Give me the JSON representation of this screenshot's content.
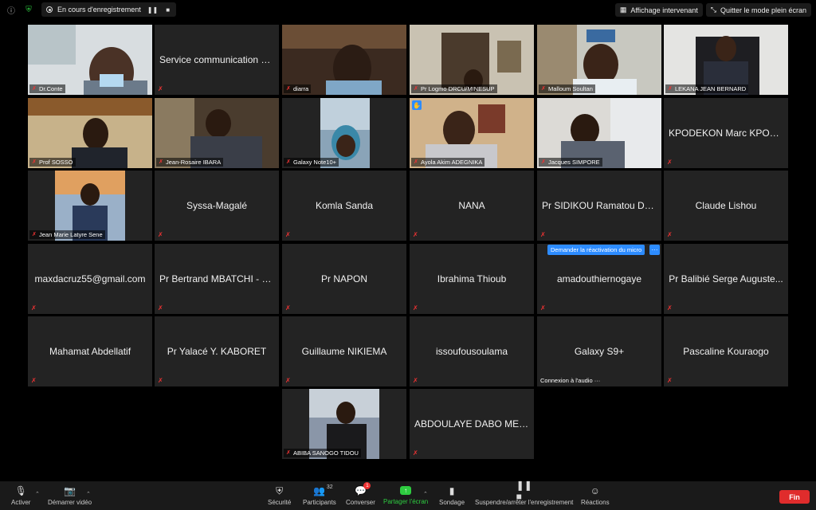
{
  "topbar": {
    "recording_label": "En cours d'enregistrement",
    "speaker_view_label": "Affichage intervenant",
    "exit_fullscreen_label": "Quitter le mode plein écran"
  },
  "participants": {
    "video": [
      {
        "name": "Dr.Conte"
      },
      {
        "name": "diarra"
      },
      {
        "name": "Pr Logmo DRCU/MINESUP"
      },
      {
        "name": "Malloum Soultan"
      },
      {
        "name": "LEKANA JEAN BERNARD"
      },
      {
        "name": "Prof SOSSO"
      },
      {
        "name": "Jean-Rosaire IBARA"
      },
      {
        "name": "Galaxy Note10+"
      },
      {
        "name": "Ayola Akim ADEGNIKA"
      },
      {
        "name": "Jacques SIMPORE"
      },
      {
        "name": "Jean Marie Latyre Sene"
      },
      {
        "name": "ABIBA SANOGO TIDOU"
      }
    ],
    "names_only": [
      {
        "name": "Service communication C..."
      },
      {
        "name": "KPODEKON Marc KPODE..."
      },
      {
        "name": "Syssa-Magalé"
      },
      {
        "name": "Komla Sanda"
      },
      {
        "name": "NANA"
      },
      {
        "name": "Pr SIDIKOU Ramatou D. S."
      },
      {
        "name": "Claude Lishou"
      },
      {
        "name": "maxdacruz55@gmail.com"
      },
      {
        "name": "Pr Bertrand MBATCHI - S..."
      },
      {
        "name": "Pr NAPON"
      },
      {
        "name": "Ibrahima Thioub"
      },
      {
        "name": "amadouthiernogaye"
      },
      {
        "name": "Pr Balibié Serge Auguste..."
      },
      {
        "name": "Mahamat Abdellatif"
      },
      {
        "name": "Pr Yalacé Y. KABORET"
      },
      {
        "name": "Guillaume NIKIEMA"
      },
      {
        "name": "issoufousoulama"
      },
      {
        "name": "Galaxy S9+"
      },
      {
        "name": "Pascaline Kouraogo"
      },
      {
        "name": "ABDOULAYE DABO MES..."
      }
    ]
  },
  "overlays": {
    "request_unmute_label": "Demander la réactivation du micro",
    "more_label": "···",
    "audio_connecting_label": "Connexion à l'audio ···"
  },
  "toolbar": {
    "mute_label": "Activer",
    "video_label": "Démarrer vidéo",
    "security_label": "Sécurité",
    "participants_label": "Participants",
    "participants_count": "32",
    "chat_label": "Converser",
    "chat_badge": "1",
    "share_label": "Partager l'écran",
    "poll_label": "Sondage",
    "record_label": "Suspendre/arrêter l'enregistrement",
    "reactions_label": "Réactions",
    "end_label": "Fin"
  },
  "colors": {
    "active_speaker": "#c8e05a",
    "accent_blue": "#2d8cff",
    "end_red": "#e02c2c",
    "share_green": "#2ecc40"
  }
}
